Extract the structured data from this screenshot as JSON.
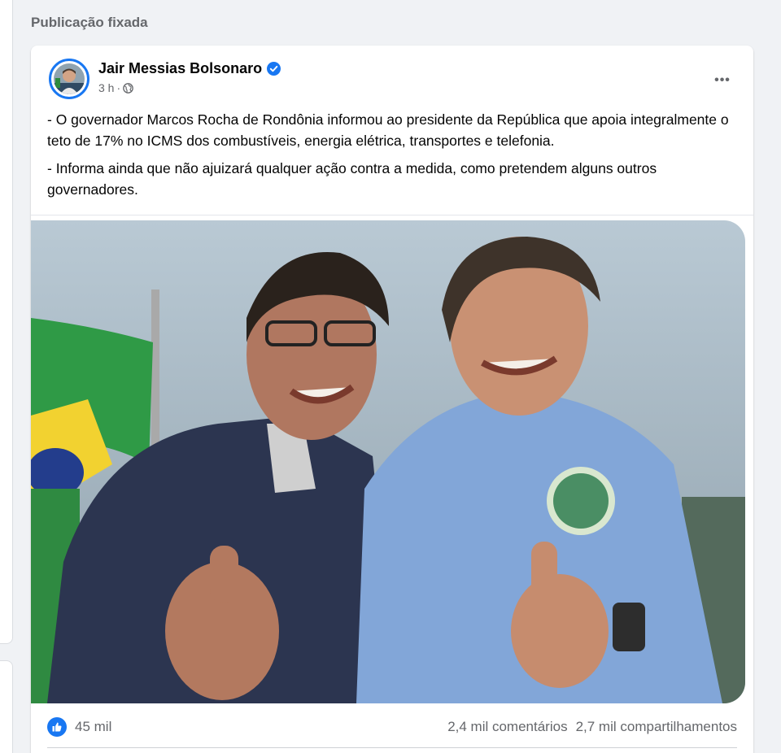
{
  "feed": {
    "pinned_heading": "Publicação fixada"
  },
  "post": {
    "author": "Jair Messias Bolsonaro",
    "time": "3 h",
    "separator": "·",
    "paragraphs": [
      "- O governador Marcos Rocha de Rondônia informou ao presidente da República que apoia integralmente o teto de 17% no ICMS dos combustíveis, energia elétrica, transportes e telefonia.",
      "- Informa ainda que não ajuizará qualquer ação contra a medida, como pretendem alguns outros governadores."
    ],
    "more_label": "•••",
    "reactions_count": "45 mil",
    "comments": "2,4 mil comentários",
    "shares": "2,7 mil compartilhamentos"
  },
  "colors": {
    "accent": "#1877f2",
    "secondary_text": "#65676b",
    "background": "#f0f2f5"
  },
  "icons": [
    "verified-badge-icon",
    "globe-icon",
    "more-options-icon",
    "like-reaction-icon"
  ]
}
